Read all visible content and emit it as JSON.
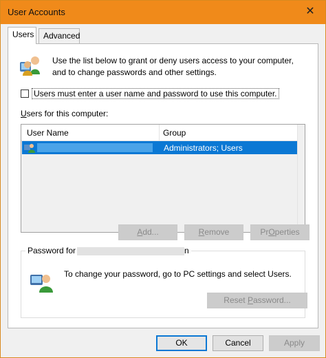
{
  "window": {
    "title": "User Accounts",
    "close_glyph": "✕"
  },
  "tabs": [
    {
      "label": "Users",
      "active": true
    },
    {
      "label": "Advanced",
      "active": false
    }
  ],
  "intro_text": "Use the list below to grant or deny users access to your computer, and to change passwords and other settings.",
  "checkbox": {
    "label": "Users must enter a user name and password to use this computer.",
    "checked": false
  },
  "users_list": {
    "label_accel": "U",
    "label_rest": "sers for this computer:",
    "columns": [
      "User Name",
      "Group"
    ],
    "rows": [
      {
        "name": "",
        "group": "Administrators; Users",
        "selected": true
      }
    ]
  },
  "list_buttons": {
    "add": {
      "accel": "A",
      "rest": "dd..."
    },
    "remove": {
      "accel": "R",
      "rest": "emove"
    },
    "properties": {
      "accel": "O",
      "pre": "Pr",
      "rest": "perties"
    }
  },
  "password_group": {
    "title_prefix": "Password for",
    "title_suffix": "n",
    "description": "To change your password, go to PC settings and select Users.",
    "reset_button": {
      "pre": "Reset ",
      "accel": "P",
      "rest": "assword..."
    }
  },
  "dialog_buttons": {
    "ok": "OK",
    "cancel": "Cancel",
    "apply": "Apply"
  },
  "colors": {
    "titlebar": "#f08a1a",
    "selection": "#0b78d4"
  },
  "icons": {
    "users": "users-icon",
    "user_row": "user-icon",
    "password_user": "password-user-icon"
  }
}
